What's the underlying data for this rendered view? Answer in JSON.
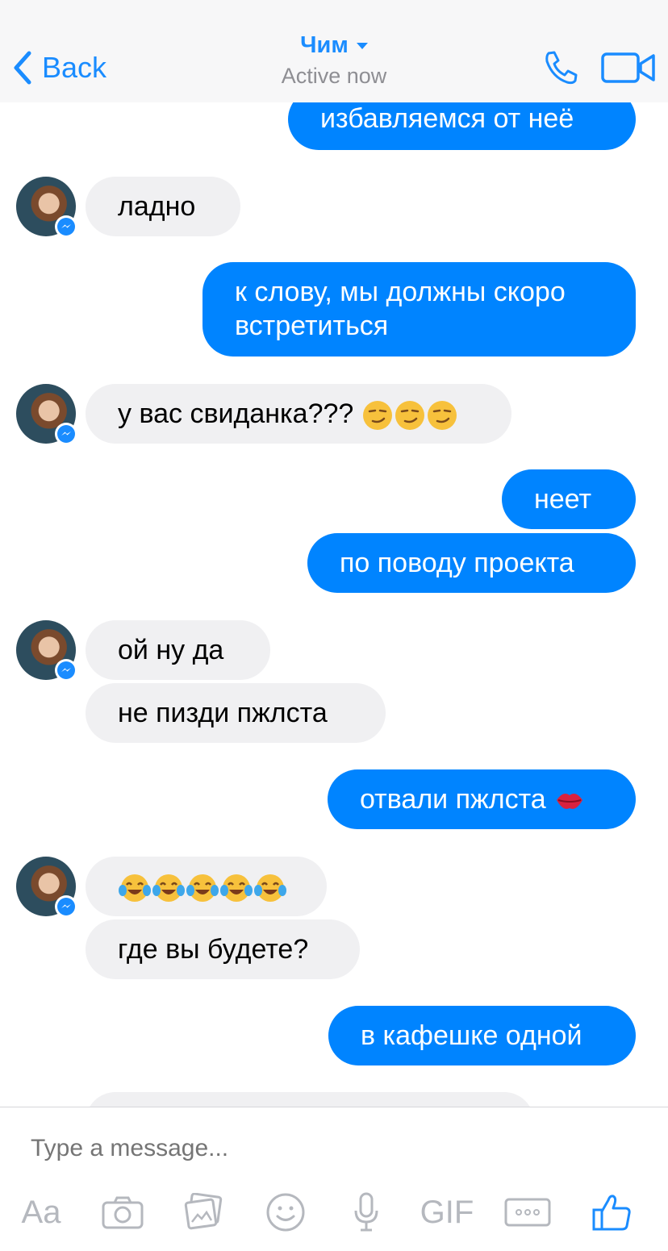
{
  "header": {
    "back_label": "Back",
    "title": "Чим",
    "subtitle": "Active now"
  },
  "messages": [
    {
      "side": "out",
      "text": "избавляемся от неё"
    },
    {
      "side": "in",
      "text": "ладно"
    },
    {
      "side": "out",
      "text": "к слову, мы должны скоро",
      "text2": "встретиться"
    },
    {
      "side": "in",
      "text": "у вас свиданка???"
    },
    {
      "side": "out",
      "text": "неет"
    },
    {
      "side": "out",
      "text": "по поводу проекта"
    },
    {
      "side": "in",
      "text": "ой ну да"
    },
    {
      "side": "in",
      "text": "не пизди пжлста"
    },
    {
      "side": "out",
      "text": "отвали пжлста"
    },
    {
      "side": "in",
      "text": ""
    },
    {
      "side": "in",
      "text": "где вы будете?"
    },
    {
      "side": "out",
      "text": "в кафешке одной"
    }
  ],
  "composer": {
    "placeholder": "Type a message...",
    "aa_label": "Aa",
    "gif_label": "GIF"
  },
  "colors": {
    "accent": "#0084ff",
    "incoming_bubble": "#f0f0f2",
    "toolbar_icon": "#b5b8be"
  }
}
